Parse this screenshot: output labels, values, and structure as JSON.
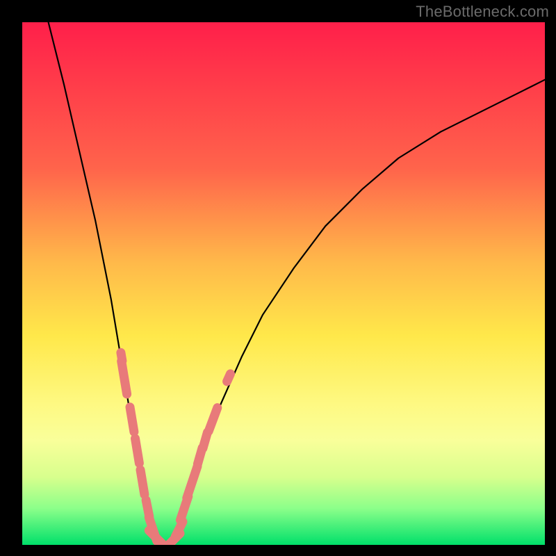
{
  "watermark": "TheBottleneck.com",
  "chart_data": {
    "type": "line",
    "title": "",
    "xlabel": "",
    "ylabel": "",
    "xlim": [
      0,
      100
    ],
    "ylim": [
      0,
      100
    ],
    "grid": false,
    "legend": false,
    "background_gradient_stops": [
      {
        "pos": 0.0,
        "color": "#ff1f4a"
      },
      {
        "pos": 0.28,
        "color": "#ff644b"
      },
      {
        "pos": 0.46,
        "color": "#ffb94a"
      },
      {
        "pos": 0.6,
        "color": "#ffe84a"
      },
      {
        "pos": 0.73,
        "color": "#fef982"
      },
      {
        "pos": 0.8,
        "color": "#f9ff9a"
      },
      {
        "pos": 0.87,
        "color": "#d8ff8d"
      },
      {
        "pos": 0.93,
        "color": "#8cff8a"
      },
      {
        "pos": 1.0,
        "color": "#00e06a"
      }
    ],
    "series": [
      {
        "name": "bottleneck-curve",
        "color": "#000000",
        "x": [
          5,
          8,
          11,
          14,
          17,
          19,
          20,
          21,
          22,
          23,
          24,
          25,
          26,
          27,
          28,
          29,
          30,
          31,
          33,
          35,
          38,
          42,
          46,
          52,
          58,
          65,
          72,
          80,
          88,
          96,
          100
        ],
        "y": [
          100,
          88,
          75,
          62,
          47,
          35,
          29,
          23,
          17,
          11,
          6,
          3,
          1,
          0,
          0,
          1,
          3,
          6,
          12,
          19,
          27,
          36,
          44,
          53,
          61,
          68,
          74,
          79,
          83,
          87,
          89
        ]
      }
    ],
    "markers": {
      "name": "data-points",
      "color": "#e87a7a",
      "shape": "pill",
      "points": [
        {
          "x": 19.0,
          "y": 36,
          "len": 1
        },
        {
          "x": 19.5,
          "y": 32,
          "len": 4
        },
        {
          "x": 21.0,
          "y": 24,
          "len": 3
        },
        {
          "x": 22.0,
          "y": 18,
          "len": 3
        },
        {
          "x": 23.0,
          "y": 12,
          "len": 3
        },
        {
          "x": 24.0,
          "y": 7,
          "len": 2
        },
        {
          "x": 25.0,
          "y": 3,
          "len": 3
        },
        {
          "x": 26.5,
          "y": 0.5,
          "len": 4
        },
        {
          "x": 28.5,
          "y": 0.5,
          "len": 3
        },
        {
          "x": 30.0,
          "y": 3,
          "len": 2
        },
        {
          "x": 31.0,
          "y": 7,
          "len": 3
        },
        {
          "x": 32.5,
          "y": 12,
          "len": 4
        },
        {
          "x": 34.0,
          "y": 17,
          "len": 2
        },
        {
          "x": 35.0,
          "y": 20,
          "len": 2
        },
        {
          "x": 36.5,
          "y": 24,
          "len": 3
        },
        {
          "x": 39.5,
          "y": 32,
          "len": 1
        }
      ]
    }
  }
}
